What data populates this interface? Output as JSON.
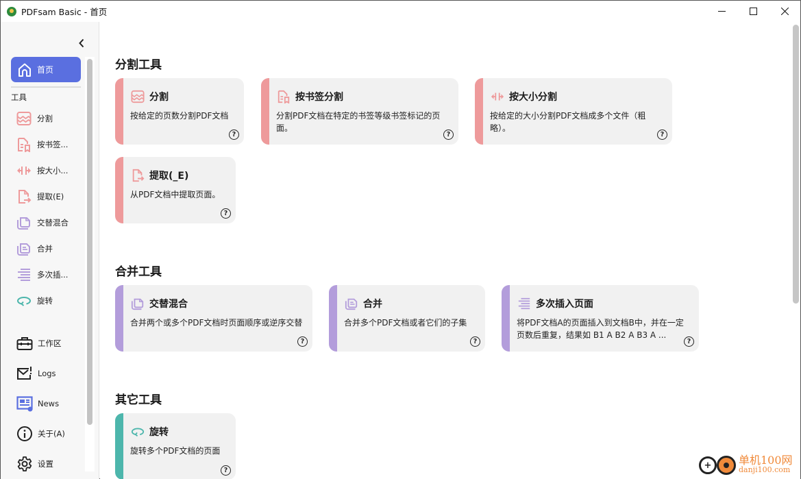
{
  "window": {
    "title": "PDFsam Basic - 首页",
    "controls": {
      "minimize": "minimize",
      "maximize": "maximize",
      "close": "close"
    }
  },
  "sidebar": {
    "home_label": "首页",
    "tools_section_label": "工具",
    "tool_items": [
      {
        "label": "分割",
        "icon": "split-icon",
        "color": "#ee9a9b"
      },
      {
        "label": "按书签...",
        "icon": "bookmark-split-icon",
        "color": "#ee9a9b"
      },
      {
        "label": "按大小...",
        "icon": "size-split-icon",
        "color": "#ee9a9b"
      },
      {
        "label": "提取(E)",
        "icon": "extract-icon",
        "color": "#ee9a9b"
      },
      {
        "label": "交替混合",
        "icon": "alternate-mix-icon",
        "color": "#b39ddb"
      },
      {
        "label": "合并",
        "icon": "merge-icon",
        "color": "#b39ddb"
      },
      {
        "label": "多次插...",
        "icon": "insert-icon",
        "color": "#b39ddb"
      },
      {
        "label": "旋转",
        "icon": "rotate-icon",
        "color": "#4db6ac"
      }
    ],
    "bottom_items": [
      {
        "label": "工作区",
        "icon": "briefcase-icon"
      },
      {
        "label": "Logs",
        "icon": "logs-mail-icon"
      },
      {
        "label": "News",
        "icon": "news-icon"
      },
      {
        "label": "关于(A)",
        "icon": "info-icon"
      },
      {
        "label": "设置",
        "icon": "gear-icon"
      }
    ]
  },
  "main": {
    "groups": [
      {
        "title": "分割工具",
        "cards": [
          {
            "title": "分割",
            "desc": "按给定的页数分割PDF文档"
          },
          {
            "title": "按书签分割",
            "desc": "分割PDF文档在特定的书签等级书签标记的页面。"
          },
          {
            "title": "按大小分割",
            "desc": "按给定的大小分割PDF文档成多个文件（粗略）。"
          },
          {
            "title": "提取(_E)",
            "desc": "从PDF文档中提取页面。"
          }
        ]
      },
      {
        "title": "合并工具",
        "cards": [
          {
            "title": "交替混合",
            "desc": "合并两个或多个PDF文档时页面顺序或逆序交替"
          },
          {
            "title": "合并",
            "desc": "合并多个PDF文档或者它们的子集"
          },
          {
            "title": "多次插入页面",
            "desc": "将PDF文档A的页面插入到文档B中，并在一定页数后重复，结果如 B1 A B2 A B3 A ..."
          }
        ]
      },
      {
        "title": "其它工具",
        "cards": [
          {
            "title": "旋转",
            "desc": "旋转多个PDF文档的页面"
          }
        ]
      }
    ],
    "help_glyph": "?"
  },
  "colors": {
    "accent": "#5a6fe0",
    "split": "#ee9a9b",
    "merge": "#b39ddb",
    "other": "#4db6ac"
  },
  "watermark": {
    "cn": "单机100网",
    "en": "danji100.com",
    "plus": "+"
  }
}
